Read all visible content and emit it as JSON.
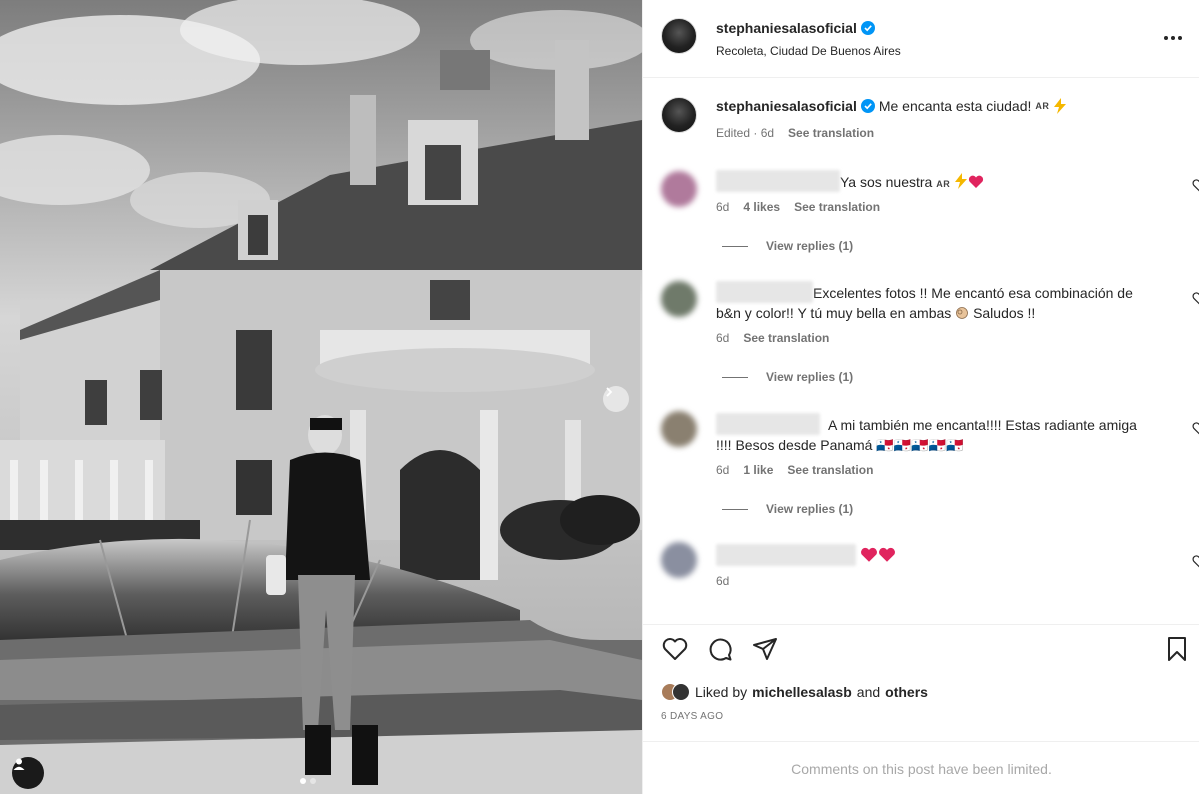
{
  "post": {
    "username": "stephaniesalasoficial",
    "location": "Recoleta, Ciudad De Buenos Aires",
    "caption_text": "Me encanta esta ciudad!",
    "caption_flag": "AR",
    "caption_edited": "Edited · 6d",
    "caption_see_translation": "See translation"
  },
  "comments": [
    {
      "text": "Ya sos nuestra",
      "flag": "AR",
      "time": "6d",
      "likes": "4 likes",
      "see_translation": "See translation",
      "view_replies": "View replies (1)",
      "avatar_color": "#b07a9c"
    },
    {
      "text": "Excelentes fotos !! Me encantó esa combinación de b&n y color!! Y tú muy bella en ambas",
      "text_tail": "Saludos !!",
      "time": "6d",
      "see_translation": "See translation",
      "view_replies": "View replies (1)",
      "avatar_color": "#6f7a6a"
    },
    {
      "text": "A mi también me encanta!!!! Estas radiante amiga !!!! Besos desde Panamá 🇵🇦🇵🇦🇵🇦🇵🇦🇵🇦",
      "time": "6d",
      "likes": "1 like",
      "see_translation": "See translation",
      "view_replies": "View replies (1)",
      "avatar_color": "#8a8070"
    },
    {
      "text": "",
      "time": "6d",
      "avatar_color": "#8a8fa0"
    }
  ],
  "footer": {
    "liked_by_prefix": "Liked by",
    "liked_by_user": "michellesalasb",
    "liked_by_and": "and",
    "liked_by_others": "others",
    "date": "6 DAYS AGO",
    "limited_notice": "Comments on this post have been limited."
  },
  "colors": {
    "verified_blue": "#0095f6",
    "heart_red": "#e0245e",
    "muted_text": "#737373"
  },
  "icons": [
    "heart-icon",
    "comment-icon",
    "share-icon",
    "bookmark-icon",
    "more-icon",
    "verified-icon",
    "chevron-right-icon",
    "user-tag-icon"
  ]
}
